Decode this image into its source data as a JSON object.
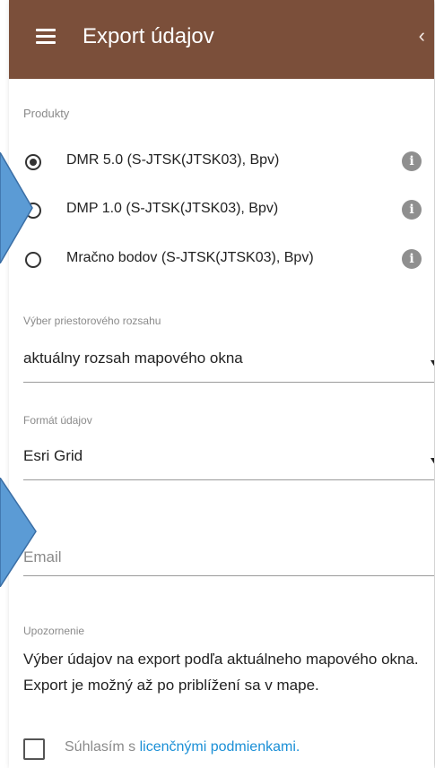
{
  "header": {
    "title": "Export údajov",
    "menu_icon": "hamburger-menu-icon",
    "collapse_icon": "chevron-left-icon",
    "color": "#7b4f3a"
  },
  "products": {
    "label": "Produkty",
    "items": [
      {
        "label": "DMR 5.0 (S-JTSK(JTSK03), Bpv)",
        "selected": true
      },
      {
        "label": "DMP 1.0 (S-JTSK(JTSK03), Bpv)",
        "selected": false
      },
      {
        "label": "Mračno bodov (S-JTSK(JTSK03), Bpv)",
        "selected": false
      }
    ],
    "info_symbol": "i"
  },
  "extent": {
    "label": "Výber priestorového rozsahu",
    "value": "aktuálny rozsah mapového okna"
  },
  "format": {
    "label": "Formát údajov",
    "value": "Esri Grid"
  },
  "email": {
    "placeholder": "Email",
    "value": ""
  },
  "notice": {
    "label": "Upozornenie",
    "text": "Výber údajov na export podľa aktuálneho mapového okna. Export je možný až po priblížení sa v mape."
  },
  "consent": {
    "prefix": "Súhlasím s ",
    "link": "licenčnými podmienkami.",
    "checked": false,
    "link_color": "#1a8fd6"
  },
  "callouts": {
    "color": "#5b9bd5"
  }
}
